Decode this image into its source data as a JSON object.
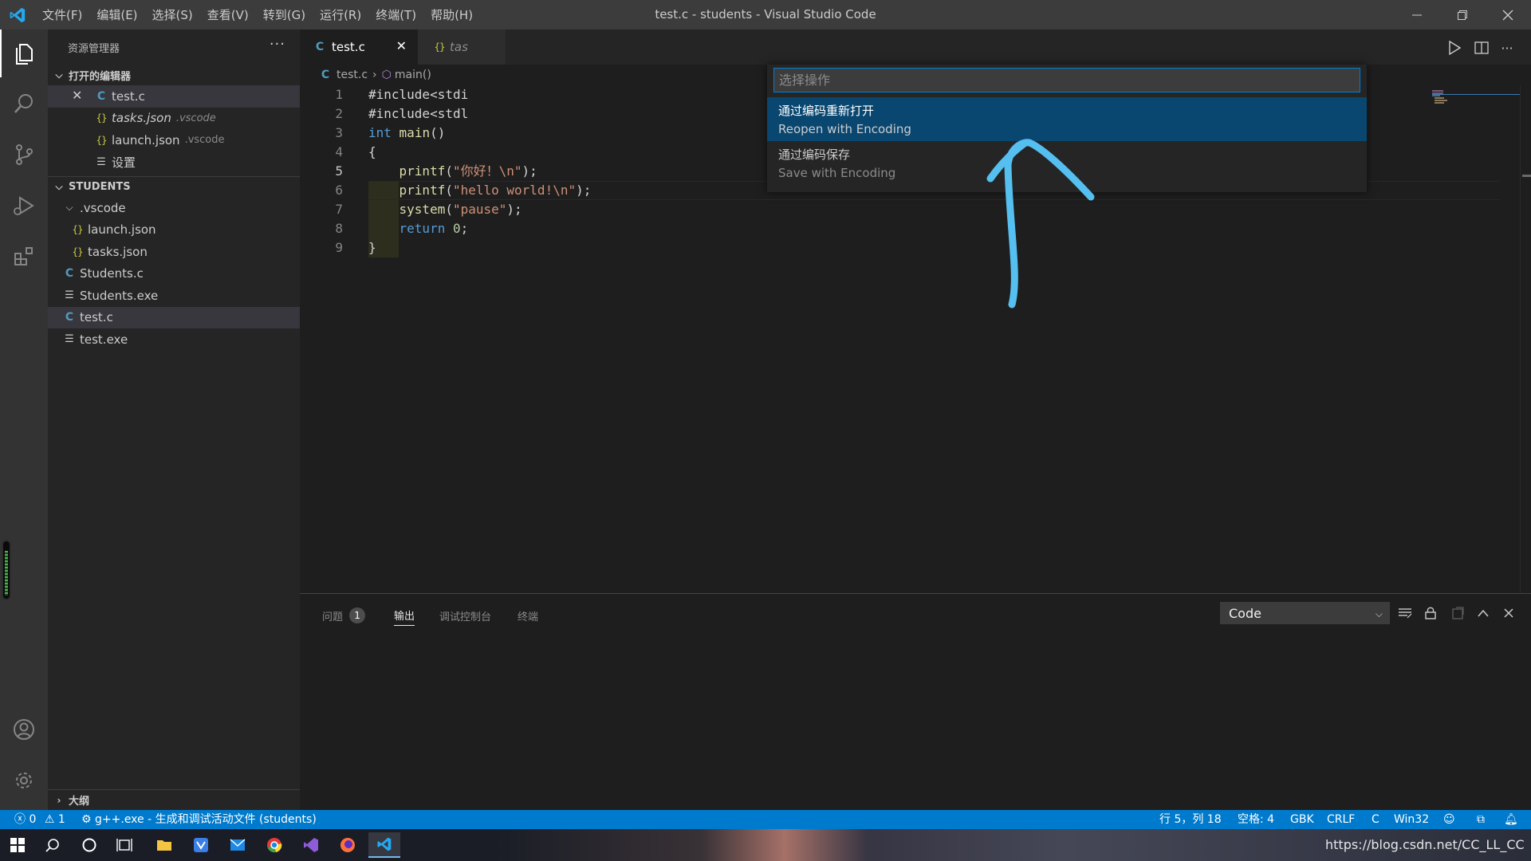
{
  "titlebar": {
    "title": "test.c - students - Visual Studio Code",
    "menus": [
      "文件(F)",
      "编辑(E)",
      "选择(S)",
      "查看(V)",
      "转到(G)",
      "运行(R)",
      "终端(T)",
      "帮助(H)"
    ]
  },
  "sidebar": {
    "header": "资源管理器",
    "more": "···",
    "open_editors": {
      "title": "打开的编辑器",
      "items": [
        {
          "name": "test.c",
          "description": ""
        },
        {
          "name": "tasks.json",
          "description": ".vscode"
        },
        {
          "name": "launch.json",
          "description": ".vscode"
        },
        {
          "name": "设置",
          "description": ""
        }
      ]
    },
    "workspace": {
      "title": "STUDENTS",
      "items": [
        ".vscode",
        "launch.json",
        "tasks.json",
        "Students.c",
        "Students.exe",
        "test.c",
        "test.exe"
      ]
    },
    "outline": "大纲"
  },
  "editor": {
    "tabs": [
      {
        "label": "test.c",
        "icon": "C"
      },
      {
        "label": "tas",
        "icon": "{}"
      }
    ],
    "breadcrumb": {
      "file": "test.c",
      "symbol": "main()"
    },
    "lines": [
      {
        "num": "1",
        "code": "#include<stdi"
      },
      {
        "num": "2",
        "code": "#include<stdl"
      },
      {
        "num": "3",
        "code": "int main()"
      },
      {
        "num": "4",
        "code": "{"
      },
      {
        "num": "5",
        "code": "    printf(\"你好！\\n\");"
      },
      {
        "num": "6",
        "code": "    printf(\"hello world!\\n\");"
      },
      {
        "num": "7",
        "code": "    system(\"pause\");"
      },
      {
        "num": "8",
        "code": "    return 0;"
      },
      {
        "num": "9",
        "code": "}"
      }
    ]
  },
  "quickpick": {
    "placeholder": "选择操作",
    "items": [
      {
        "label": "通过编码重新打开",
        "description": "Reopen with Encoding"
      },
      {
        "label": "通过编码保存",
        "description": "Save with Encoding"
      }
    ]
  },
  "panel": {
    "tabs": [
      "问题",
      "输出",
      "调试控制台",
      "终端"
    ],
    "problems_count": "1",
    "output_channel": "Code"
  },
  "statusbar": {
    "errors": "0",
    "warnings": "1",
    "task": "g++.exe - 生成和调试活动文件 (students)",
    "position": "行 5，列 18",
    "spaces": "空格: 4",
    "encoding": "GBK",
    "eol": "CRLF",
    "language": "C",
    "platform": "Win32"
  },
  "taskbar": {
    "watermark": "https://blog.csdn.net/CC_LL_CC"
  },
  "colors": {
    "accent": "#007acc",
    "annotation_arrow": "#55bff0",
    "selection": "#094771"
  }
}
